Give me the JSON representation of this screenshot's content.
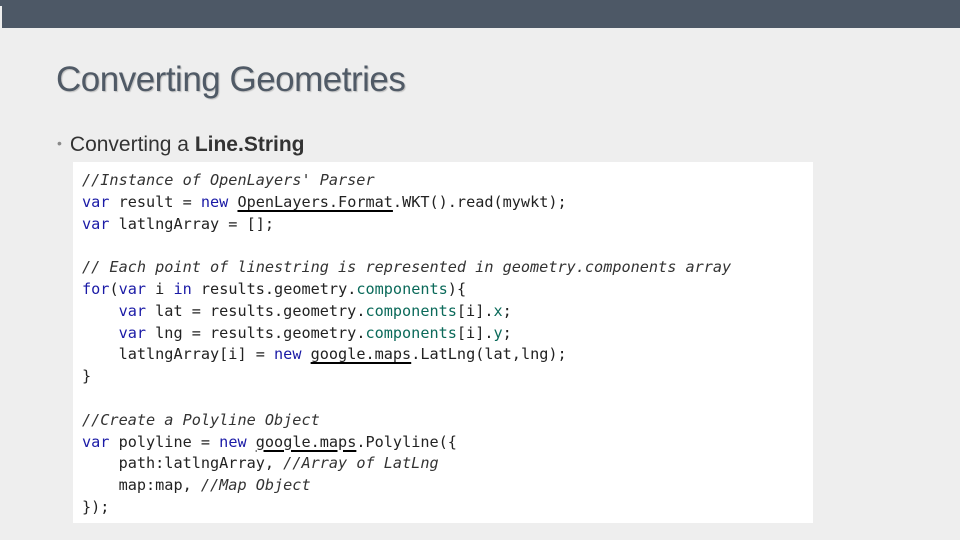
{
  "slide": {
    "title": "Converting Geometries",
    "bullet": {
      "prefix": "Converting a ",
      "emphasis": "Line.String"
    }
  },
  "code": {
    "c1": "//Instance of OpenLayers' Parser",
    "kw_var": "var",
    "kw_new": "new",
    "kw_for": "for",
    "kw_in": "in",
    "l2_a": " result = ",
    "l2_ns": "OpenLayers.Format",
    "l2_b": ".WKT().read(mywkt);",
    "l3_a": " latlngArray = [];",
    "c2": "// Each point of linestring is represented in geometry.components array",
    "l5_a": "(",
    "l5_b": " i ",
    "l5_c": " results.geometry.",
    "comp": "components",
    "l5_d": "){",
    "ind": "    ",
    "l6_a": " lat = results.geometry.",
    "l6_b": "[i].",
    "x": "x",
    "semi": ";",
    "l7_a": " lng = results.geometry.",
    "y": "y",
    "l8_a": "latlngArray[i] = ",
    "sp": " ",
    "gmaps": "google.maps",
    "l8_b": ".LatLng(lat,lng);",
    "close": "}",
    "c3": "//Create a Polyline Object",
    "l12_a": " polyline = ",
    "l12_b": ".Polyline({",
    "l13_a": "path:latlngArray, ",
    "c4": "//Array of LatLng",
    "l14_a": "map:map, ",
    "c5": "//Map Object",
    "l15": "});"
  }
}
